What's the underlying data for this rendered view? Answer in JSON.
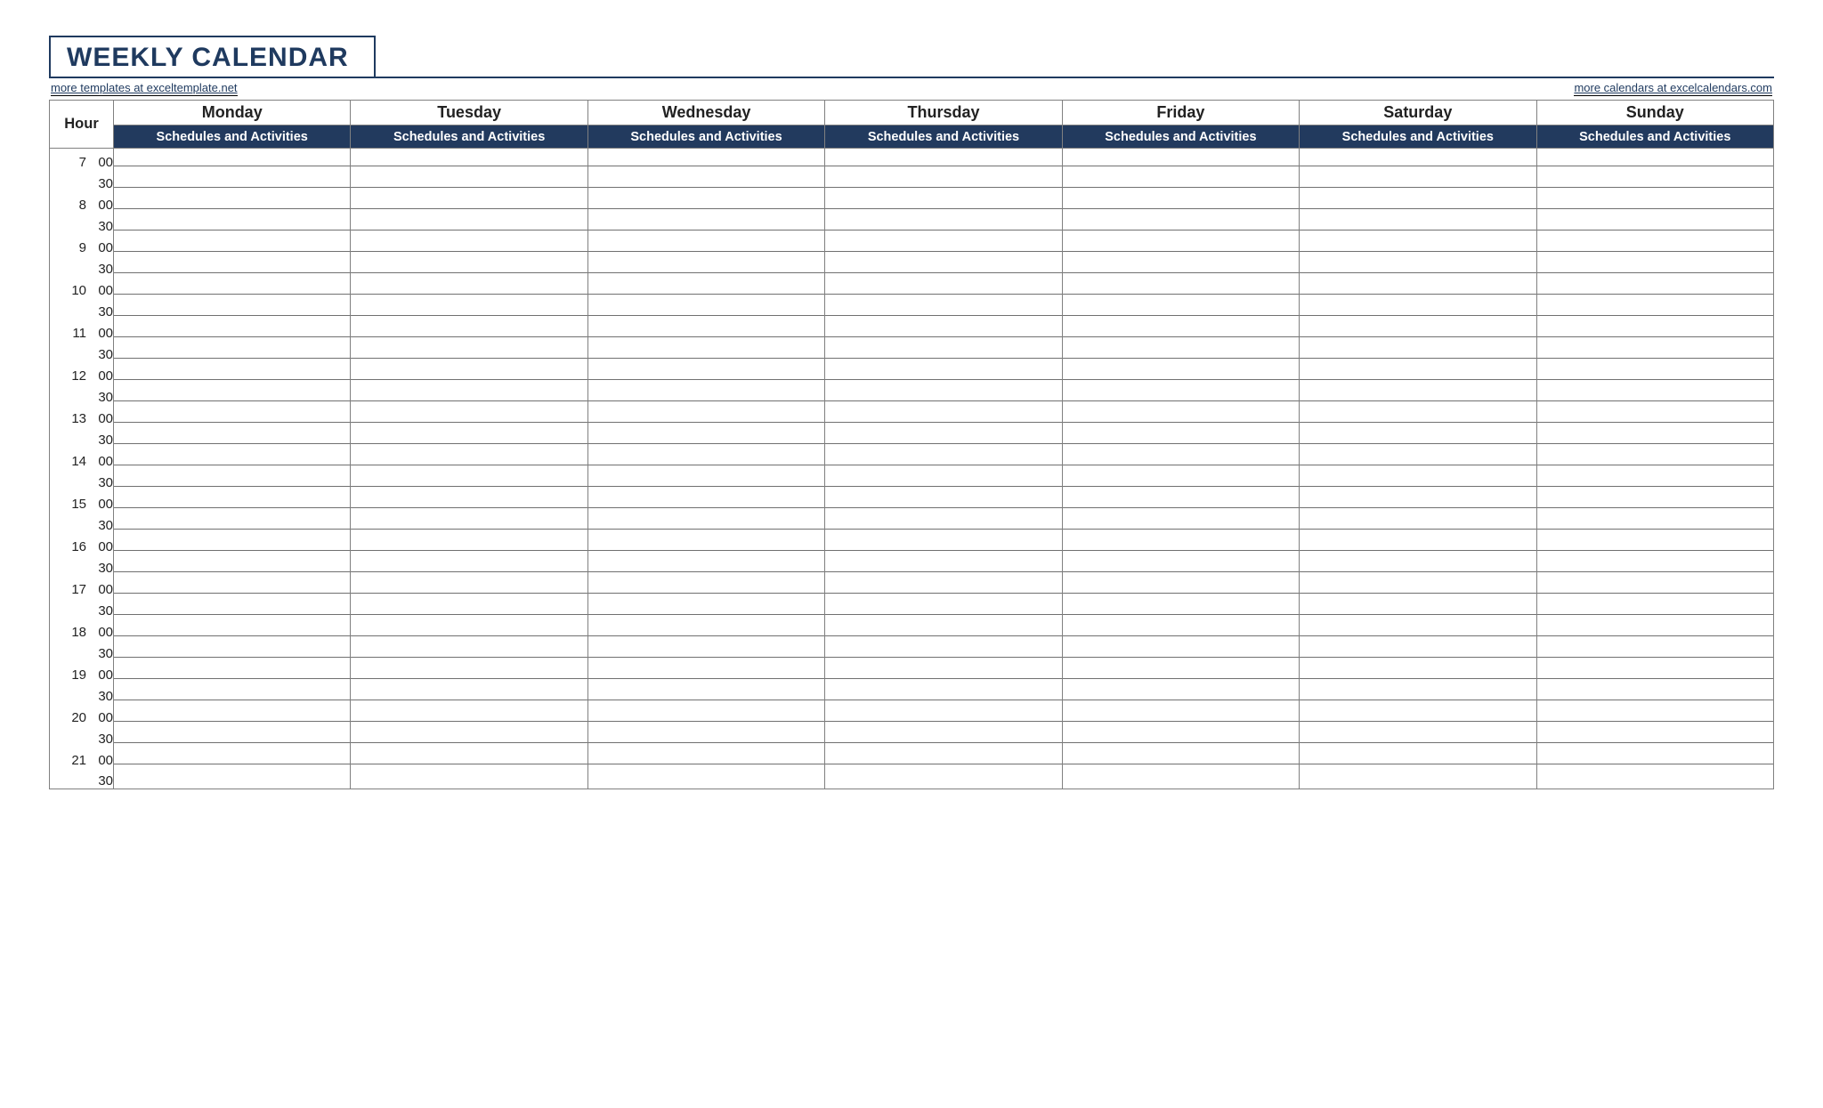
{
  "title": "WEEKLY CALENDAR",
  "links": {
    "left": "more templates at exceltemplate.net",
    "right": "more calendars at excelcalendars.com"
  },
  "headers": {
    "hour": "Hour",
    "sub": "Schedules and Activities",
    "days": [
      "Monday",
      "Tuesday",
      "Wednesday",
      "Thursday",
      "Friday",
      "Saturday",
      "Sunday"
    ]
  },
  "time_slots": [
    {
      "hour": "7",
      "min": "00"
    },
    {
      "hour": "",
      "min": "30"
    },
    {
      "hour": "8",
      "min": "00"
    },
    {
      "hour": "",
      "min": "30"
    },
    {
      "hour": "9",
      "min": "00"
    },
    {
      "hour": "",
      "min": "30"
    },
    {
      "hour": "10",
      "min": "00"
    },
    {
      "hour": "",
      "min": "30"
    },
    {
      "hour": "11",
      "min": "00"
    },
    {
      "hour": "",
      "min": "30"
    },
    {
      "hour": "12",
      "min": "00"
    },
    {
      "hour": "",
      "min": "30"
    },
    {
      "hour": "13",
      "min": "00"
    },
    {
      "hour": "",
      "min": "30"
    },
    {
      "hour": "14",
      "min": "00"
    },
    {
      "hour": "",
      "min": "30"
    },
    {
      "hour": "15",
      "min": "00"
    },
    {
      "hour": "",
      "min": "30"
    },
    {
      "hour": "16",
      "min": "00"
    },
    {
      "hour": "",
      "min": "30"
    },
    {
      "hour": "17",
      "min": "00"
    },
    {
      "hour": "",
      "min": "30"
    },
    {
      "hour": "18",
      "min": "00"
    },
    {
      "hour": "",
      "min": "30"
    },
    {
      "hour": "19",
      "min": "00"
    },
    {
      "hour": "",
      "min": "30"
    },
    {
      "hour": "20",
      "min": "00"
    },
    {
      "hour": "",
      "min": "30"
    },
    {
      "hour": "21",
      "min": "00"
    },
    {
      "hour": "",
      "min": "30"
    }
  ]
}
